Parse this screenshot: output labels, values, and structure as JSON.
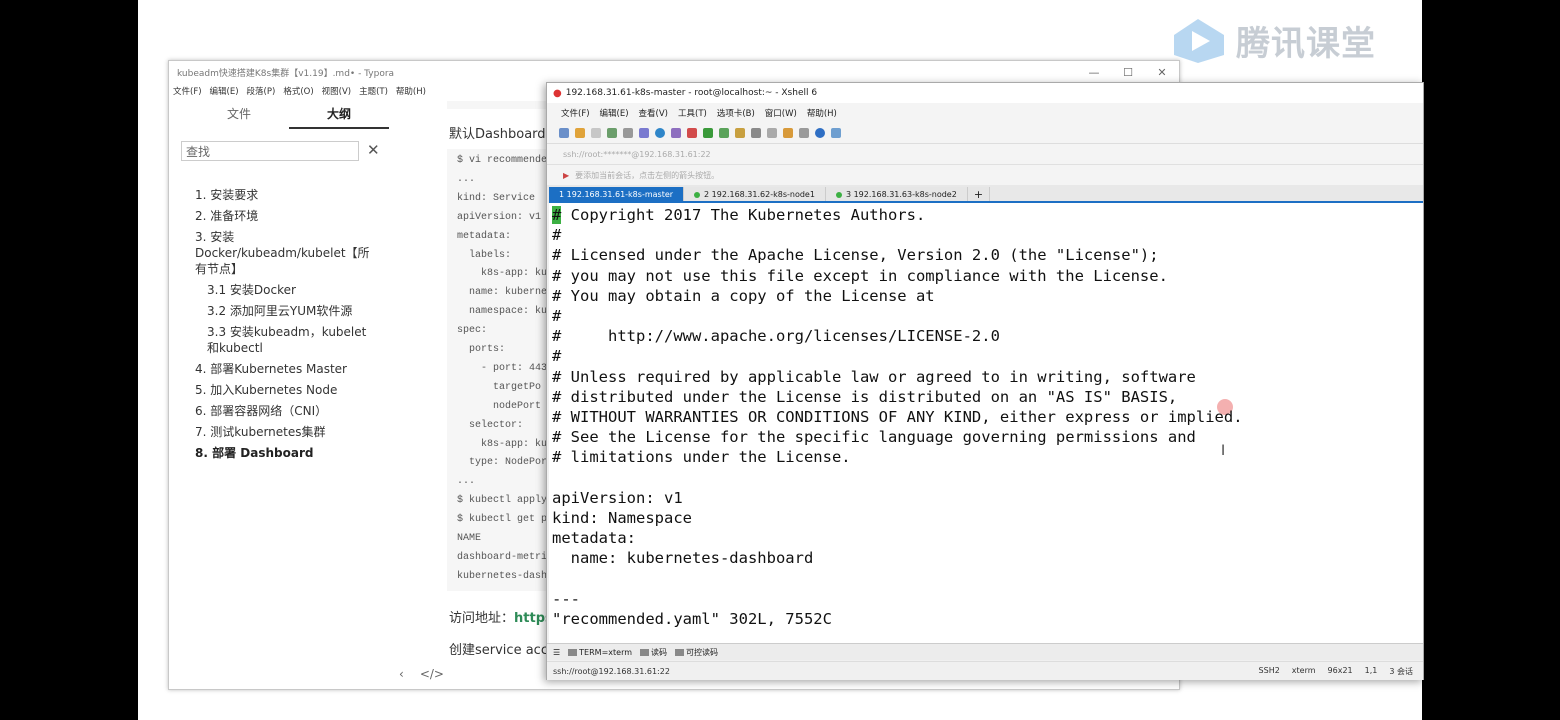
{
  "watermark": {
    "text": "腾讯课堂"
  },
  "typora": {
    "title": "kubeadm快速搭建K8s集群【v1.19】.md• - Typora",
    "window_controls": [
      "—",
      "☐",
      "✕"
    ],
    "menu": [
      "文件(F)",
      "编辑(E)",
      "段落(P)",
      "格式(O)",
      "视图(V)",
      "主题(T)",
      "帮助(H)"
    ],
    "sidebar": {
      "tabs": [
        "文件",
        "大纲"
      ],
      "search_placeholder": "查找",
      "outline": [
        "1. 安装要求",
        "2. 准备环境",
        "3. 安装Docker/kubeadm/kubelet【所有节点】",
        "3.1 安装Docker",
        "3.2 添加阿里云YUM软件源",
        "3.3 安装kubeadm，kubelet和kubectl",
        "4. 部署Kubernetes Master",
        "5. 加入Kubernetes Node",
        "6. 部署容器网络（CNI）",
        "7. 测试kubernetes集群",
        "8. 部署 Dashboard"
      ],
      "bottom_icons": [
        "‹",
        "</>"
      ]
    },
    "doc": {
      "para1": "默认Dashboard",
      "code_lines": [
        "$ vi recommended",
        "...",
        "kind: Service",
        "apiVersion: v1",
        "metadata:",
        "  labels:",
        "    k8s-app: ku",
        "  name: kubernet",
        "  namespace: kub",
        "spec:",
        "  ports:",
        "    - port: 443",
        "      targetPo",
        "      nodePort",
        "  selector:",
        "    k8s-app: ku",
        "  type: NodePort",
        "...",
        "$ kubectl apply",
        "$ kubectl get po",
        "NAME",
        "dashboard-metric",
        "kubernetes-dashb"
      ],
      "access_label": "访问地址：",
      "access_link": "https",
      "create_sa": "创建service acco"
    }
  },
  "xshell": {
    "title": "192.168.31.61-k8s-master - root@localhost:~ - Xshell 6",
    "menu": [
      "文件(F)",
      "编辑(E)",
      "查看(V)",
      "工具(T)",
      "选项卡(B)",
      "窗口(W)",
      "帮助(H)"
    ],
    "address": "ssh://root:*******@192.168.31.61:22",
    "hint": "要添加当前会话，点击左侧的箭头按钮。",
    "tabs": [
      {
        "label": "1 192.168.31.61-k8s-master",
        "active": true
      },
      {
        "label": "2 192.168.31.62-k8s-node1",
        "active": false
      },
      {
        "label": "3 192.168.31.63-k8s-node2",
        "active": false
      }
    ],
    "terminal_lines": [
      " Copyright 2017 The Kubernetes Authors.",
      "#",
      "# Licensed under the Apache License, Version 2.0 (the \"License\");",
      "# you may not use this file except in compliance with the License.",
      "# You may obtain a copy of the License at",
      "#",
      "#     http://www.apache.org/licenses/LICENSE-2.0",
      "#",
      "# Unless required by applicable law or agreed to in writing, software",
      "# distributed under the License is distributed on an \"AS IS\" BASIS,",
      "# WITHOUT WARRANTIES OR CONDITIONS OF ANY KIND, either express or implied.",
      "# See the License for the specific language governing permissions and",
      "# limitations under the License.",
      "",
      "apiVersion: v1",
      "kind: Namespace",
      "metadata:",
      "  name: kubernetes-dashboard",
      "",
      "---",
      "\"recommended.yaml\" 302L, 7552C"
    ],
    "cursor_char": "#",
    "compose": [
      "TERM=xterm",
      "读码",
      "可控读码"
    ],
    "status_left": "ssh://root@192.168.31.61:22",
    "status_right": [
      "SSH2",
      "xterm",
      "96x21",
      "1,1",
      "3 会话"
    ],
    "colors": {
      "tab_active": "#1c6fc4",
      "cursor": "#3cb043"
    }
  }
}
